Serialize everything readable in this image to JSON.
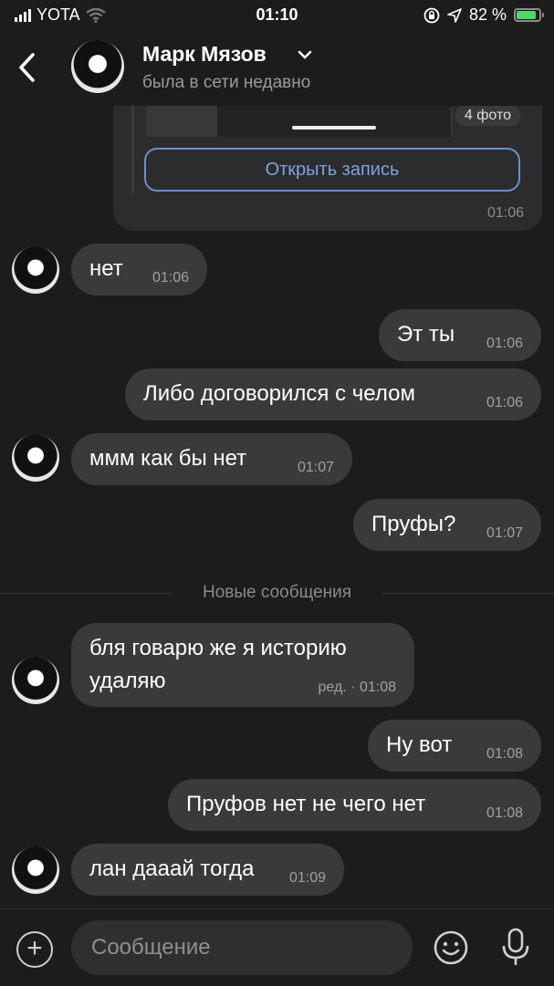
{
  "status": {
    "carrier": "YOTA",
    "time": "01:10",
    "battery": "82 %"
  },
  "header": {
    "name": "Марк Мязов",
    "subtitle": "была в сети недавно"
  },
  "post": {
    "photo_count": "4 фото",
    "open_label": "Открыть запись",
    "time": "01:06"
  },
  "messages": [
    {
      "dir": "in",
      "text": "нет",
      "time": "01:06"
    },
    {
      "dir": "out",
      "text": "Эт ты",
      "time": "01:06"
    },
    {
      "dir": "out",
      "text": "Либо договорился с челом",
      "time": "01:06"
    },
    {
      "dir": "in",
      "text": "ммм как бы нет",
      "time": "01:07"
    },
    {
      "dir": "out",
      "text": "Пруфы?",
      "time": "01:07"
    },
    {
      "dir": "in",
      "text_line1": "бля говарю же я историю",
      "text_line2": "удаляю",
      "time": "ред. · 01:08"
    },
    {
      "dir": "out",
      "text": "Ну вот",
      "time": "01:08"
    },
    {
      "dir": "out",
      "text": "Пруфов нет не чего нет",
      "time": "01:08"
    },
    {
      "dir": "in",
      "text": "лан дааай тогда",
      "time": "01:09"
    }
  ],
  "divider": {
    "label": "Новые сообщения"
  },
  "composer": {
    "placeholder": "Сообщение"
  }
}
